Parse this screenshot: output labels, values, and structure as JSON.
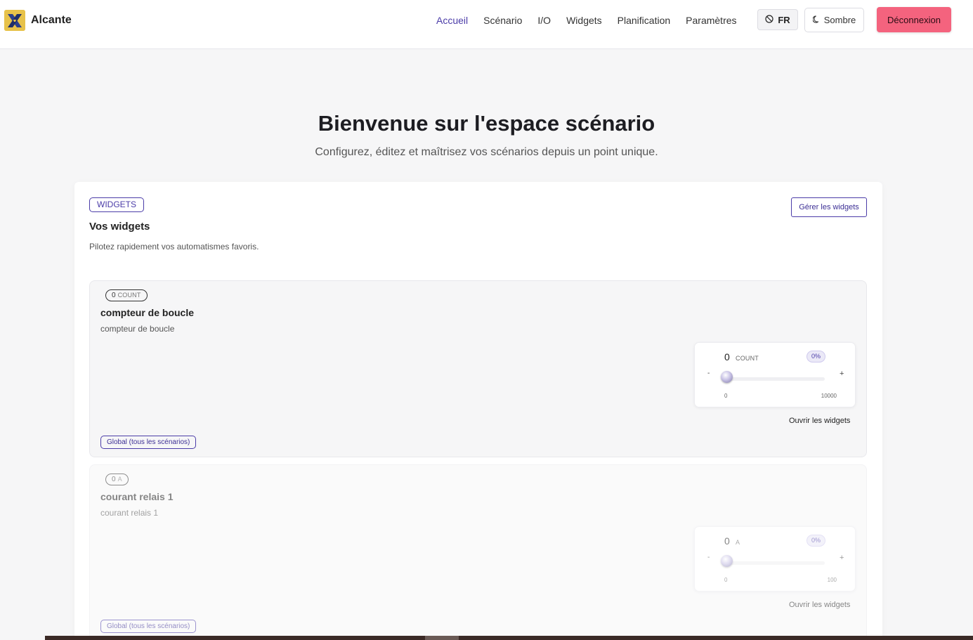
{
  "header": {
    "brand": "Alcante",
    "nav": [
      {
        "label": "Accueil",
        "active": true
      },
      {
        "label": "Scénario",
        "active": false
      },
      {
        "label": "I/O",
        "active": false
      },
      {
        "label": "Widgets",
        "active": false
      },
      {
        "label": "Planification",
        "active": false
      },
      {
        "label": "Paramètres",
        "active": false
      }
    ],
    "lang_label": "FR",
    "theme_label": "Sombre",
    "logout_label": "Déconnexion"
  },
  "hero": {
    "title": "Bienvenue sur l'espace scénario",
    "subtitle": "Configurez, éditez et maîtrisez vos scénarios depuis un point unique."
  },
  "panel": {
    "tag": "WIDGETS",
    "manage_label": "Gérer les widgets",
    "title": "Vos widgets",
    "description": "Pilotez rapidement vos automatismes favoris."
  },
  "widgets": [
    {
      "badge_value": "0",
      "badge_unit": "COUNT",
      "title": "compteur de boucle",
      "description": "compteur de boucle",
      "value": "0",
      "unit": "COUNT",
      "percent": "0%",
      "level": 0,
      "minus": "-",
      "plus": "+",
      "min": "0",
      "max": "10000",
      "open_label": "Ouvrir les widgets",
      "scope": "Global (tous les scénarios)"
    },
    {
      "badge_value": "0",
      "badge_unit": "A",
      "title": "courant relais 1",
      "description": "courant relais 1",
      "value": "0",
      "unit": "A",
      "percent": "0%",
      "level": 0,
      "minus": "-",
      "plus": "+",
      "min": "0",
      "max": "100",
      "open_label": "Ouvrir les widgets",
      "scope": "Global (tous les scénarios)"
    }
  ],
  "colors": {
    "accent": "#4b3ca8",
    "logout": "#f4637e",
    "background": "#f6f6f7"
  }
}
